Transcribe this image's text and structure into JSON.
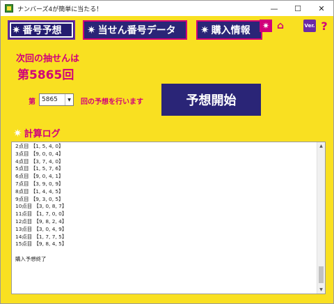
{
  "window": {
    "title": "ナンバーズ4が簡単に当たる！",
    "minimize": "—",
    "maximize": "☐",
    "close": "✕"
  },
  "nav": {
    "tabs": [
      {
        "label": "番号予想",
        "icon": "star-burst-icon"
      },
      {
        "label": "当せん番号データ",
        "icon": "star-burst-icon"
      },
      {
        "label": "購入情報",
        "icon": "star-burst-icon"
      }
    ],
    "star": "✷",
    "ver_label": "Ver.",
    "help": "?"
  },
  "next_draw": {
    "label": "次回の抽せんは",
    "number": "第5865回"
  },
  "predict": {
    "prefix": "第",
    "selected": "5865",
    "suffix": "回の予想を行います",
    "button": "予想開始"
  },
  "log": {
    "title": "計算ログ",
    "lines": [
      "2点目 【1, 5, 4, 0】",
      "3点目 【9, 0, 0, 4】",
      "4点目 【3, 7, 4, 0】",
      "5点目 【1, 5, 7, 6】",
      "6点目 【9, 0, 4, 1】",
      "7点目 【3, 9, 0, 9】",
      "8点目 【1, 4, 4, 5】",
      "9点目 【9, 3, 0, 5】",
      "10点目 【3, 0, 8, 7】",
      "11点目 【1, 7, 0, 0】",
      "12点目 【9, 8, 2, 4】",
      "13点目 【3, 0, 4, 9】",
      "14点目 【1, 7, 7, 5】",
      "15点目 【9, 8, 4, 5】",
      "",
      "購入予想終了"
    ]
  }
}
